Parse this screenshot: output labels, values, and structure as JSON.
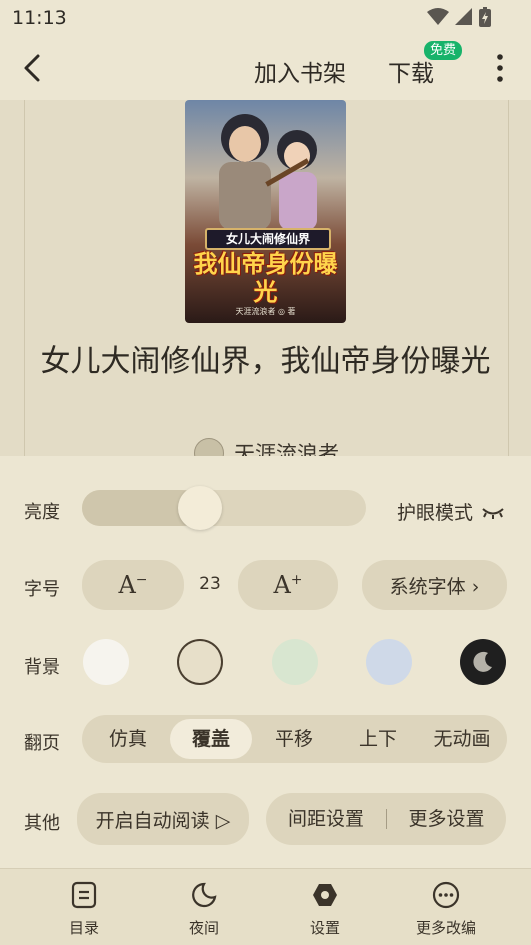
{
  "status_bar": {
    "time": "11:13"
  },
  "top_bar": {
    "add_to_shelf": "加入书架",
    "download": "下载",
    "free_badge": "免费"
  },
  "book": {
    "cover_banner": "女儿大闹修仙界",
    "cover_title": "我仙帝身份曝光",
    "cover_author": "天涯流浪者 ◎ 著",
    "title": "女儿大闹修仙界，我仙帝身份曝光",
    "author": "天涯流浪者"
  },
  "settings": {
    "brightness": {
      "label": "亮度",
      "level": 0.4,
      "eye_mode_label": "护眼模式"
    },
    "font": {
      "label": "字号",
      "size_value": "23",
      "system_font_label": "系统字体 ›"
    },
    "background": {
      "label": "背景",
      "swatches": [
        "#f6f4ee",
        "#e7dfc9",
        "#d8e6d0",
        "#cfd9e8",
        "#1f1f1f"
      ],
      "selected_index": 1
    },
    "page_flip": {
      "label": "翻页",
      "options": [
        "仿真",
        "覆盖",
        "平移",
        "上下",
        "无动画"
      ],
      "selected_index": 1
    },
    "other": {
      "label": "其他",
      "auto_read_label": "开启自动阅读 ▷",
      "spacing_label": "间距设置",
      "more_settings_label": "更多设置"
    }
  },
  "bottom_nav": [
    {
      "label": "目录",
      "icon": "catalog-icon"
    },
    {
      "label": "夜间",
      "icon": "moon-icon"
    },
    {
      "label": "设置",
      "icon": "settings-icon"
    },
    {
      "label": "更多改编",
      "icon": "more-circle-icon"
    }
  ],
  "colors": {
    "panel_bg": "#ece6d2",
    "pill_bg": "#ddd5bd",
    "badge_green": "#18b36a"
  }
}
